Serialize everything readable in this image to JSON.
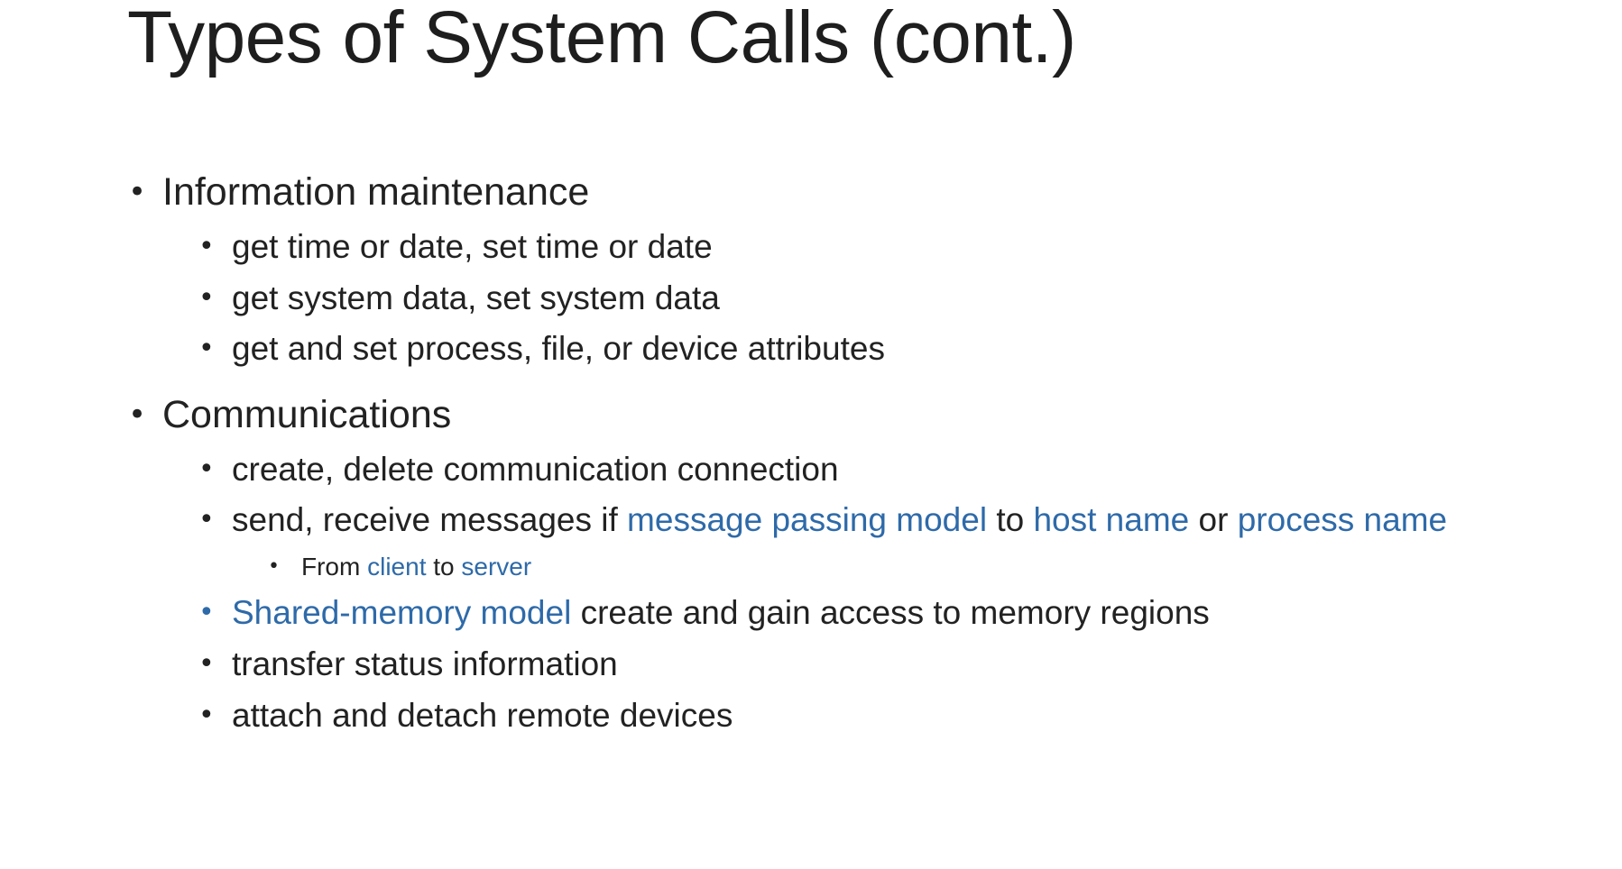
{
  "slide": {
    "title": "Types of System Calls (cont.)",
    "accent_color": "#2e6aa9",
    "sections": [
      {
        "heading": "Information maintenance",
        "items": [
          "get time or date, set time or date",
          "get system data, set system data",
          "get and set process, file, or device attributes"
        ]
      },
      {
        "heading": "Communications",
        "items": [
          "create, delete communication connection",
          {
            "part1": "send, receive messages if ",
            "link1": "message passing model",
            "part2": " to ",
            "link2": "host name",
            "part3": " or ",
            "link3": "process name"
          },
          {
            "part1": "From ",
            "link1": "client",
            "part2": " to ",
            "link2": "server"
          },
          {
            "link1": "Shared-memory model",
            "part1": " create and gain access to memory regions"
          },
          "transfer status information",
          "attach and detach remote devices"
        ]
      }
    ]
  }
}
